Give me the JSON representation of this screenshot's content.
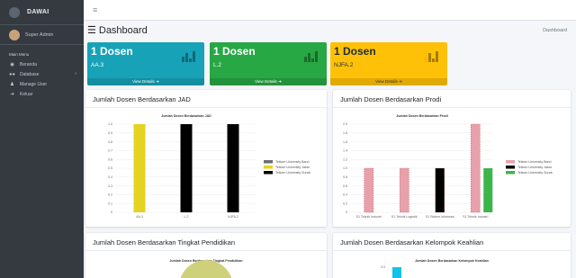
{
  "brand": {
    "name": "DAWAI"
  },
  "user": {
    "name": "Super Admin"
  },
  "nav": {
    "header": "Main Menu",
    "items": [
      {
        "label": "Beranda",
        "icon": "dashboard-icon"
      },
      {
        "label": "Database",
        "icon": "users-icon",
        "has_caret": true
      },
      {
        "label": "Manage User",
        "icon": "user-gear-icon"
      },
      {
        "label": "Keluar",
        "icon": "sign-out-icon"
      }
    ]
  },
  "page": {
    "title": "Dashboard",
    "breadcrumb": "Dashboard"
  },
  "boxes": [
    {
      "count": "1 Dosen",
      "label": "AA.3",
      "link": "View Details",
      "color": "#17a2b8"
    },
    {
      "count": "1 Dosen",
      "label": "L.2",
      "link": "View Details",
      "color": "#28a745"
    },
    {
      "count": "1 Dosen",
      "label": "NJFA.2",
      "link": "View Details",
      "color": "#ffc107"
    }
  ],
  "cards": {
    "jad": {
      "header": "Jumlah Dosen Berdasarkan JAD"
    },
    "prodi": {
      "header": "Jumlah Dosen Berdasarkan Prodi"
    },
    "pendidikan": {
      "header": "Jumlah Dosen Berdasarkan Tingkat Pendidikan"
    },
    "kk": {
      "header": "Jumlah Dosen Berdasarkan Kelompok Keahlian"
    }
  },
  "chart_data": [
    {
      "type": "bar",
      "title": "Jumlah Dosen Berdasarkan JAD",
      "categories": [
        "AA.3",
        "L.2",
        "NJFA.2"
      ],
      "series": [
        {
          "name": "Telkom University Bandung",
          "values": [
            1,
            1,
            1
          ]
        },
        {
          "name": "Telkom University Jakarta",
          "values": [
            1,
            0,
            0
          ]
        },
        {
          "name": "Telkom University Surabaya",
          "values": [
            0,
            1,
            1
          ]
        }
      ],
      "colors": [
        "#6e6e6e",
        "#e5d321",
        "#000000"
      ],
      "bar_colors": [
        "#e5d321",
        "#000000",
        "#000000"
      ],
      "yticks": [
        "0",
        "0.1",
        "0.2",
        "0.3",
        "0.4",
        "0.5",
        "0.6",
        "0.7",
        "0.8",
        "0.9",
        "1.0"
      ],
      "ylim": [
        0,
        1.0
      ],
      "legend": "right",
      "legend_labels": [
        "Telkom University Band",
        "Telkom University Jakar",
        "Telkom University Surab"
      ]
    },
    {
      "type": "bar",
      "title": "Jumlah Dosen Berdasarkan Prodi",
      "categories": [
        "S1 Teknik Industri",
        "S1 Teknik Logistik",
        "S1 Sistem Informasi",
        "S1 Teknik Industri"
      ],
      "values": [
        1,
        1,
        1,
        2
      ],
      "bar_colors": [
        "#e8a1aa",
        "#e8a1aa",
        "#000000",
        "#e8a1aa"
      ],
      "extra_bar": {
        "after_category": 3,
        "value": 1,
        "color": "#3cb54a"
      },
      "series_colors": [
        "#e8a1aa",
        "#000000",
        "#3cb54a"
      ],
      "yticks": [
        "0",
        "0.2",
        "0.4",
        "0.6",
        "0.8",
        "1.0",
        "1.2",
        "1.4",
        "1.6",
        "1.8",
        "2.0"
      ],
      "ylim": [
        0,
        2.0
      ],
      "legend": "right",
      "legend_labels": [
        "Telkom University Band",
        "Telkom University Jakar",
        "Telkom University Surab"
      ]
    },
    {
      "type": "pie",
      "title": "Jumlah Dosen Berdasarkan Tingkat Pendidikan",
      "note": "partially visible"
    },
    {
      "type": "bar",
      "title": "Jumlah Dosen Berdasarkan Kelompok Keahlian",
      "yticks": [
        "3.0"
      ],
      "note": "partially visible"
    }
  ]
}
